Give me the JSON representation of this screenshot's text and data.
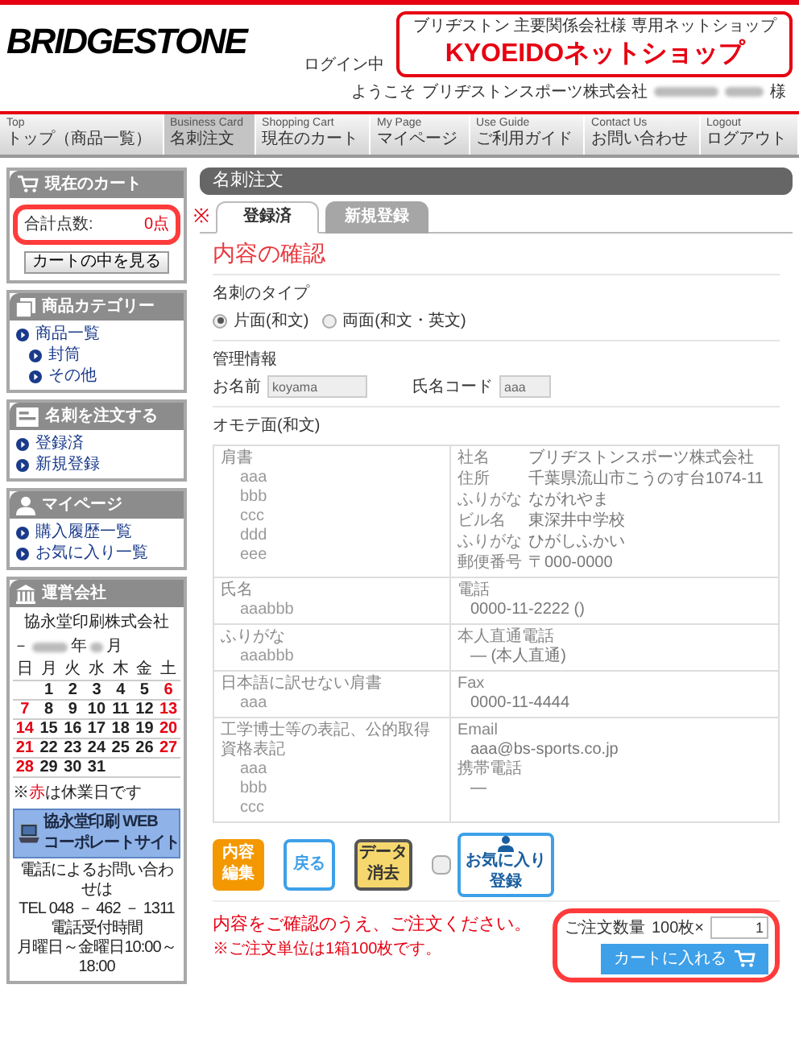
{
  "header": {
    "logo": "BRIDGESTONE",
    "login_status": "ログイン中",
    "welcome": "ようこそ",
    "company": "ブリヂストンスポーツ株式会社",
    "honorific": "様",
    "shop_banner": {
      "subtitle": "ブリヂストン 主要関係会社様 専用ネットショップ",
      "title": "KYOEIDOネットショップ"
    }
  },
  "nav": [
    {
      "en": "Top",
      "label": "トップ（商品一覧）",
      "selected": false
    },
    {
      "en": "Business Card",
      "label": "名刺注文",
      "selected": true
    },
    {
      "en": "Shopping Cart",
      "label": "現在のカート",
      "selected": false
    },
    {
      "en": "My Page",
      "label": "マイページ",
      "selected": false
    },
    {
      "en": "Use Guide",
      "label": "ご利用ガイド",
      "selected": false
    },
    {
      "en": "Contact Us",
      "label": "お問い合わせ",
      "selected": false
    },
    {
      "en": "Logout",
      "label": "ログアウト",
      "selected": false
    }
  ],
  "sidebar": {
    "cart": {
      "title": "現在のカート",
      "total_label": "合計点数:",
      "total_value": "0点",
      "view_button": "カートの中を見る"
    },
    "sections": [
      {
        "kind": "category",
        "title": "商品カテゴリー",
        "items": [
          {
            "label": "商品一覧",
            "children": [
              {
                "label": "封筒"
              },
              {
                "label": "その他"
              }
            ]
          }
        ]
      },
      {
        "kind": "order",
        "title": "名刺を注文する",
        "items": [
          {
            "label": "登録済"
          },
          {
            "label": "新規登録"
          }
        ]
      },
      {
        "kind": "mypage",
        "title": "マイページ",
        "items": [
          {
            "label": "購入履歴一覧"
          },
          {
            "label": "お気に入り一覧"
          }
        ]
      }
    ],
    "company": {
      "title": "運営会社",
      "name": "協永堂印刷株式会社",
      "month_prefix": "－",
      "year_suffix": "年",
      "month_suffix": "月",
      "weekdays": [
        "日",
        "月",
        "火",
        "水",
        "木",
        "金",
        "土"
      ],
      "weeks": [
        [
          {
            "day": "1",
            "holiday": false
          },
          {
            "day": "2",
            "holiday": false
          },
          {
            "day": "3",
            "holiday": false
          },
          {
            "day": "4",
            "holiday": false
          },
          {
            "day": "5",
            "holiday": false
          },
          {
            "day": "6",
            "holiday": true
          }
        ],
        [
          {
            "day": "7",
            "holiday": true
          },
          {
            "day": "8",
            "holiday": false
          },
          {
            "day": "9",
            "holiday": false
          },
          {
            "day": "10",
            "holiday": false
          },
          {
            "day": "11",
            "holiday": false
          },
          {
            "day": "12",
            "holiday": false
          },
          {
            "day": "13",
            "holiday": true
          }
        ],
        [
          {
            "day": "14",
            "holiday": true
          },
          {
            "day": "15",
            "holiday": false
          },
          {
            "day": "16",
            "holiday": false
          },
          {
            "day": "17",
            "holiday": false
          },
          {
            "day": "18",
            "holiday": false
          },
          {
            "day": "19",
            "holiday": false
          },
          {
            "day": "20",
            "holiday": true
          }
        ],
        [
          {
            "day": "21",
            "holiday": true
          },
          {
            "day": "22",
            "holiday": false
          },
          {
            "day": "23",
            "holiday": false
          },
          {
            "day": "24",
            "holiday": false
          },
          {
            "day": "25",
            "holiday": false
          },
          {
            "day": "26",
            "holiday": false
          },
          {
            "day": "27",
            "holiday": true
          }
        ],
        [
          {
            "day": "28",
            "holiday": true
          },
          {
            "day": "29",
            "holiday": false
          },
          {
            "day": "30",
            "holiday": false
          },
          {
            "day": "31",
            "holiday": false
          }
        ]
      ],
      "note_prefix": "※",
      "note_red": "赤",
      "note_suffix": "は休業日です",
      "banner": [
        "協永堂印刷 WEB",
        "コーポレートサイト"
      ],
      "contact": [
        "電話によるお問い合わせは",
        "TEL 048 － 462 － 1311",
        "電話受付時間",
        "月曜日～金曜日10:00～18:00"
      ]
    }
  },
  "main": {
    "title": "名刺注文",
    "mark": "※",
    "tabs": [
      {
        "label": "登録済",
        "selected": true
      },
      {
        "label": "新規登録",
        "selected": false
      }
    ],
    "heading": "内容の確認",
    "card_type": {
      "label": "名刺のタイプ",
      "options": [
        {
          "label": "片面(和文)",
          "selected": true
        },
        {
          "label": "両面(和文・英文)",
          "selected": false
        }
      ]
    },
    "management": {
      "label": "管理情報",
      "fields": [
        {
          "label": "お名前",
          "value": "koyama"
        },
        {
          "label": "氏名コード",
          "value": "aaa"
        }
      ]
    },
    "front_label": "オモテ面(和文)",
    "rows": [
      {
        "left": {
          "label": "肩書",
          "values": [
            "aaa",
            "bbb",
            "ccc",
            "ddd",
            "eee"
          ]
        },
        "right": {
          "kind": "pairs",
          "pairs": [
            {
              "label": "社名",
              "value": "ブリヂストンスポーツ株式会社"
            },
            {
              "label": "住所",
              "value": "千葉県流山市こうのす台1074-11"
            },
            {
              "label": "ふりがな",
              "value": "ながれやま"
            },
            {
              "label": "ビル名",
              "value": "東深井中学校"
            },
            {
              "label": "ふりがな",
              "value": "ひがしふかい"
            },
            {
              "label": "郵便番号",
              "value": "〒000-0000"
            }
          ]
        }
      },
      {
        "left": {
          "label": "氏名",
          "values": [
            "aaabbb"
          ]
        },
        "right": {
          "kind": "fields",
          "fields": [
            {
              "label": "電話",
              "values": [
                "0000-11-2222 ()"
              ]
            }
          ]
        }
      },
      {
        "left": {
          "label": "ふりがな",
          "values": [
            "aaabbb"
          ]
        },
        "right": {
          "kind": "fields",
          "fields": [
            {
              "label": "本人直通電話",
              "values": [
                "— (本人直通)"
              ]
            }
          ]
        }
      },
      {
        "left": {
          "label": "日本語に訳せない肩書",
          "values": [
            "aaa"
          ]
        },
        "right": {
          "kind": "fields",
          "fields": [
            {
              "label": "Fax",
              "values": [
                "0000-11-4444"
              ]
            }
          ]
        }
      },
      {
        "left": {
          "label": "工学博士等の表記、公的取得資格表記",
          "values": [
            "aaa",
            "bbb",
            "ccc"
          ]
        },
        "right": {
          "kind": "fields",
          "fields": [
            {
              "label": "Email",
              "values": [
                "aaa@bs-sports.co.jp"
              ]
            },
            {
              "label": "携帯電話",
              "values": [
                "—"
              ]
            }
          ]
        }
      }
    ],
    "actions": [
      {
        "kind": "edit",
        "lines": [
          "内容",
          "編集"
        ]
      },
      {
        "kind": "back",
        "lines": [
          "戻る"
        ]
      },
      {
        "kind": "clear",
        "lines": [
          "データ",
          "消去"
        ]
      },
      {
        "kind": "checkbox",
        "checked": false
      },
      {
        "kind": "favorite",
        "lines": [
          "お気に入り",
          "登録"
        ]
      }
    ],
    "message": "内容をご確認のうえ、ご注文ください。",
    "note": "※ご注文単位は1箱100枚です。",
    "quantity": {
      "label": "ご注文数量",
      "unit": "100枚×",
      "value": "1"
    },
    "cart_button": "カートに入れる"
  }
}
